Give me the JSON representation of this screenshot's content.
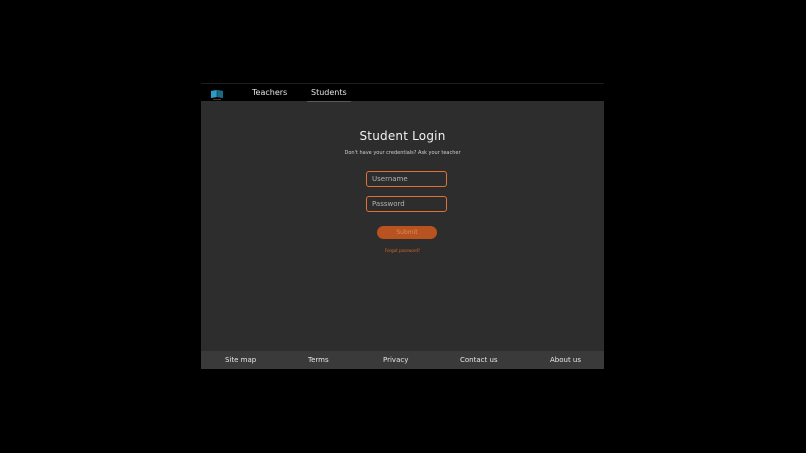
{
  "nav": {
    "tabs": [
      {
        "label": "Teachers"
      },
      {
        "label": "Students",
        "active": true
      }
    ]
  },
  "login": {
    "title": "Student Login",
    "subtitle": "Don't have your credentials? Ask your teacher",
    "username_placeholder": "Username",
    "password_placeholder": "Password",
    "submit_label": "Submit",
    "forgot_label": "Forgot password?"
  },
  "footer": {
    "links": [
      {
        "label": "Site map"
      },
      {
        "label": "Terms"
      },
      {
        "label": "Privacy"
      },
      {
        "label": "Contact us"
      },
      {
        "label": "About us"
      }
    ]
  },
  "colors": {
    "accent": "#e0703a",
    "button": "#b8531f",
    "panel": "#2d2d2d",
    "footer": "#3a3a3a",
    "background": "#000000"
  },
  "icons": {
    "logo": "book-logo-icon"
  }
}
